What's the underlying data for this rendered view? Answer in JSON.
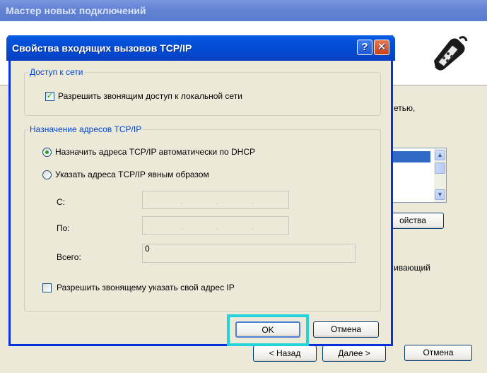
{
  "wizard": {
    "title": "Мастер новых подключений",
    "text_network": "етью,",
    "text_calling": "ивающий",
    "properties_button": "ойства",
    "back_button": "< Назад",
    "next_button": "Далее >",
    "cancel_button": "Отмена"
  },
  "dialog": {
    "title": "Свойства входящих вызовов TCP/IP",
    "help_glyph": "?",
    "close_glyph": "✕",
    "network_access": {
      "group_label": "Доступ к сети",
      "allow_lan_label": "Разрешить звонящим доступ к локальной сети",
      "allow_lan_checked": true
    },
    "tcpip_assignment": {
      "group_label": "Назначение адресов TCP/IP",
      "dhcp_label": "Назначить адреса TCP/IP автоматически по DHCP",
      "dhcp_selected": true,
      "explicit_label": "Указать адреса TCP/IP явным образом",
      "from_label": "С:",
      "to_label": "По:",
      "total_label": "Всего:",
      "total_value": "0",
      "allow_caller_ip_label": "Разрешить звонящему указать свой адрес IP",
      "allow_caller_ip_checked": false
    },
    "ok_button": "OK",
    "cancel_button": "Отмена"
  },
  "colors": {
    "dialog_titlebar": "#0451d9",
    "group_label": "#0046d5",
    "focus_highlight": "#22d3dc",
    "check_mark": "#21a121"
  },
  "icons": {
    "wizard_icon": "phone-handset-icon",
    "help": "help-icon",
    "close": "close-icon"
  }
}
